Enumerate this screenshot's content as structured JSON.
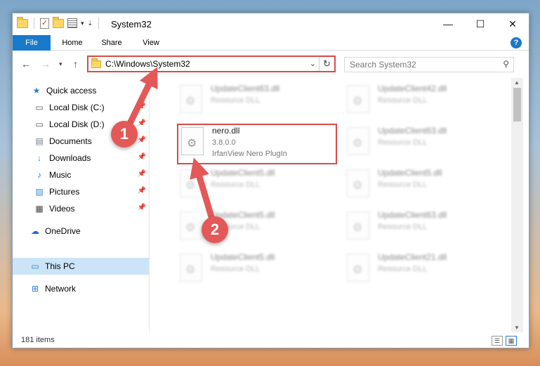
{
  "window": {
    "title": "System32",
    "controls": {
      "minimize": "—",
      "maximize": "☐",
      "close": "✕"
    }
  },
  "ribbon": {
    "tabs": [
      {
        "label": "File"
      },
      {
        "label": "Home"
      },
      {
        "label": "Share"
      },
      {
        "label": "View"
      }
    ]
  },
  "address": {
    "path": "C:\\Windows\\System32"
  },
  "search": {
    "placeholder": "Search System32"
  },
  "sidebar": {
    "items": [
      {
        "label": "Quick access",
        "icon": "star-icon"
      },
      {
        "label": "Local Disk (C:)",
        "icon": "drive-icon"
      },
      {
        "label": "Local Disk (D:)",
        "icon": "drive-icon"
      },
      {
        "label": "Documents",
        "icon": "documents-icon"
      },
      {
        "label": "Downloads",
        "icon": "download-icon"
      },
      {
        "label": "Music",
        "icon": "music-icon"
      },
      {
        "label": "Pictures",
        "icon": "pictures-icon"
      },
      {
        "label": "Videos",
        "icon": "videos-icon"
      },
      {
        "label": "OneDrive",
        "icon": "cloud-icon"
      },
      {
        "label": "This PC",
        "icon": "computer-icon"
      },
      {
        "label": "Network",
        "icon": "network-icon"
      }
    ]
  },
  "files": {
    "focus": {
      "name": "nero.dll",
      "version": "3.8.0.0",
      "description": "IrfanView Nero PlugIn"
    },
    "background": [
      {
        "name": "UpdateClient63.dll",
        "type": "Resource DLL"
      },
      {
        "name": "UpdateClient42.dll",
        "type": "Resource DLL"
      },
      {
        "name": "UpdateClient63.dll",
        "type": "Resource DLL"
      },
      {
        "name": "UpdateClient5.dll",
        "type": "Resource DLL"
      },
      {
        "name": "UpdateClient5.dll",
        "type": "Resource DLL"
      },
      {
        "name": "UpdateClient5.dll",
        "type": "Resource DLL"
      },
      {
        "name": "UpdateClient63.dll",
        "type": "Resource DLL"
      },
      {
        "name": "UpdateClient5.dll",
        "type": "Resource DLL"
      },
      {
        "name": "UpdateClient21.dll",
        "type": "Resource DLL"
      }
    ]
  },
  "status": {
    "item_count": "181 items"
  },
  "annotations": {
    "step1": "1",
    "step2": "2",
    "color": "#e45858"
  }
}
